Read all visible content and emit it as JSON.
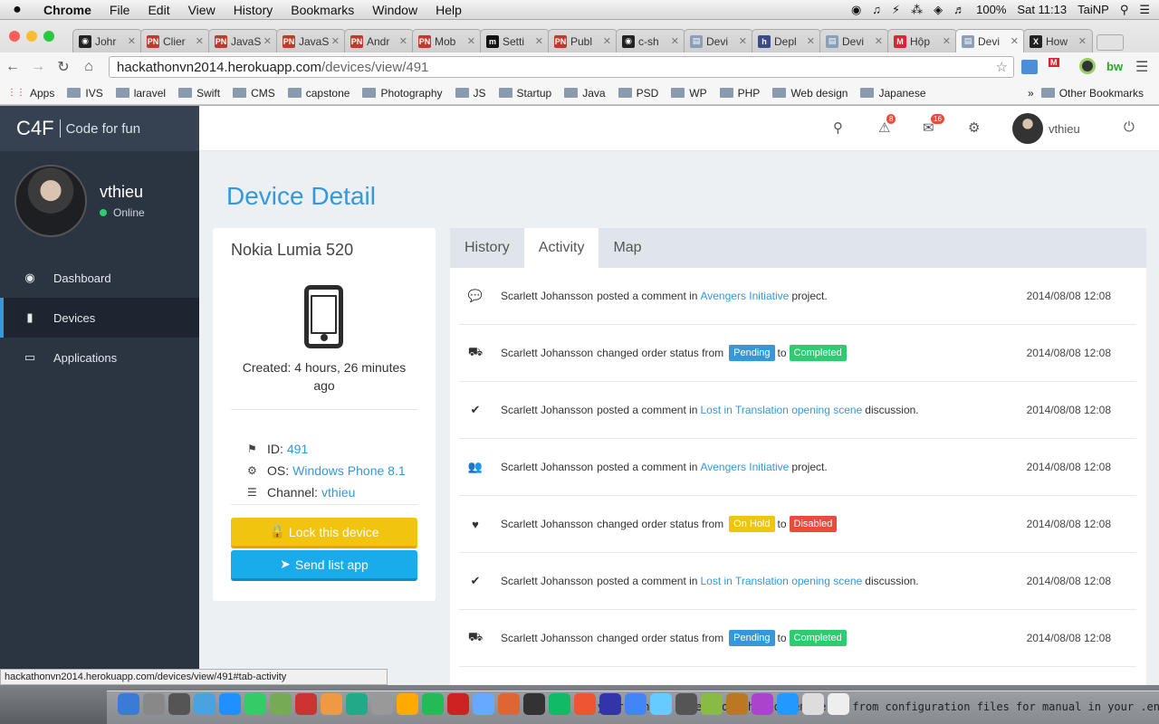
{
  "menubar": {
    "apple": "",
    "app": "Chrome",
    "items": [
      "File",
      "Edit",
      "View",
      "History",
      "Bookmarks",
      "Window",
      "Help"
    ],
    "battery": "100%",
    "clock": "Sat 11:13",
    "user": "TaiNP"
  },
  "tabs": [
    {
      "label": "Johr",
      "fav": "gh"
    },
    {
      "label": "Clier",
      "fav": "PN"
    },
    {
      "label": "JavaS",
      "fav": "PN"
    },
    {
      "label": "JavaS",
      "fav": "PN"
    },
    {
      "label": "Andr",
      "fav": "PN"
    },
    {
      "label": "Mob",
      "fav": "PN"
    },
    {
      "label": "Setti",
      "fav": "m"
    },
    {
      "label": "Publ",
      "fav": "PN"
    },
    {
      "label": "c-sh",
      "fav": "gh"
    },
    {
      "label": "Devi",
      "fav": "dv"
    },
    {
      "label": "Depl",
      "fav": "h"
    },
    {
      "label": "Devi",
      "fav": "dv"
    },
    {
      "label": "Hộp",
      "fav": "M"
    },
    {
      "label": "Devi",
      "fav": "dv"
    },
    {
      "label": "How",
      "fav": "X"
    }
  ],
  "toolbar": {
    "url_host": "hackathonvn2014.herokuapp.com",
    "url_path": "/devices/view/491"
  },
  "bookmarks": [
    "Apps",
    "IVS",
    "laravel",
    "Swift",
    "CMS",
    "capstone",
    "Photography",
    "JS",
    "Startup",
    "Java",
    "PSD",
    "WP",
    "PHP",
    "Web design",
    "Japanese"
  ],
  "bookmarks_other": "Other Bookmarks",
  "brand": {
    "logo": "C4F",
    "tagline": "Code for fun"
  },
  "profile": {
    "name": "vthieu",
    "status": "Online"
  },
  "nav": [
    {
      "label": "Dashboard",
      "icon": "dashboard-icon"
    },
    {
      "label": "Devices",
      "icon": "mobile-icon"
    },
    {
      "label": "Applications",
      "icon": "laptop-icon"
    }
  ],
  "topbar": {
    "alerts": "8",
    "messages": "16",
    "user": "vthieu"
  },
  "page": {
    "title": "Device Detail"
  },
  "device": {
    "name": "Nokia Lumia 520",
    "created": "Created: 4 hours, 26 minutes ago",
    "id_label": "ID:",
    "id": "491",
    "os_label": "OS:",
    "os": "Windows Phone 8.1",
    "channel_label": "Channel:",
    "channel": "vthieu",
    "lock_btn": "Lock this device",
    "send_btn": "Send list app"
  },
  "panel_tabs": [
    "History",
    "Activity",
    "Map"
  ],
  "activity": [
    {
      "icon": "comment-icon",
      "who": "Scarlett Johansson",
      "pre": "posted a comment in",
      "link": "Avengers Initiative",
      "post": "project.",
      "time": "2014/08/08 12:08"
    },
    {
      "icon": "truck-icon",
      "who": "Scarlett Johansson",
      "pre": "changed order status from",
      "from": "Pending",
      "to_word": "to",
      "to": "Completed",
      "from_color": "#3498db",
      "to_color": "#2ecc71",
      "time": "2014/08/08 12:08"
    },
    {
      "icon": "check-icon",
      "who": "Scarlett Johansson",
      "pre": "posted a comment in",
      "link": "Lost in Translation opening scene",
      "post": "discussion.",
      "time": "2014/08/08 12:08"
    },
    {
      "icon": "users-icon",
      "who": "Scarlett Johansson",
      "pre": "posted a comment in",
      "link": "Avengers Initiative",
      "post": "project.",
      "time": "2014/08/08 12:08"
    },
    {
      "icon": "heart-icon",
      "who": "Scarlett Johansson",
      "pre": "changed order status from",
      "from": "On Hold",
      "to_word": "to",
      "to": "Disabled",
      "from_color": "#f1c40f",
      "to_color": "#e74c3c",
      "time": "2014/08/08 12:08"
    },
    {
      "icon": "check-icon",
      "who": "Scarlett Johansson",
      "pre": "posted a comment in",
      "link": "Lost in Translation opening scene",
      "post": "discussion.",
      "time": "2014/08/08 12:08"
    },
    {
      "icon": "truck-icon",
      "who": "Scarlett Johansson",
      "pre": "changed order status from",
      "from": "Pending",
      "to_word": "to",
      "to": "Completed",
      "from_color": "#3498db",
      "to_color": "#2ecc71",
      "time": "2014/08/08 12:08"
    }
  ],
  "statusbar": "hackathonvn2014.herokuapp.com/devices/view/491#tab-activity",
  "dock_terminal": "In your config file, you should remove it from configuration files for manual in your .env file"
}
